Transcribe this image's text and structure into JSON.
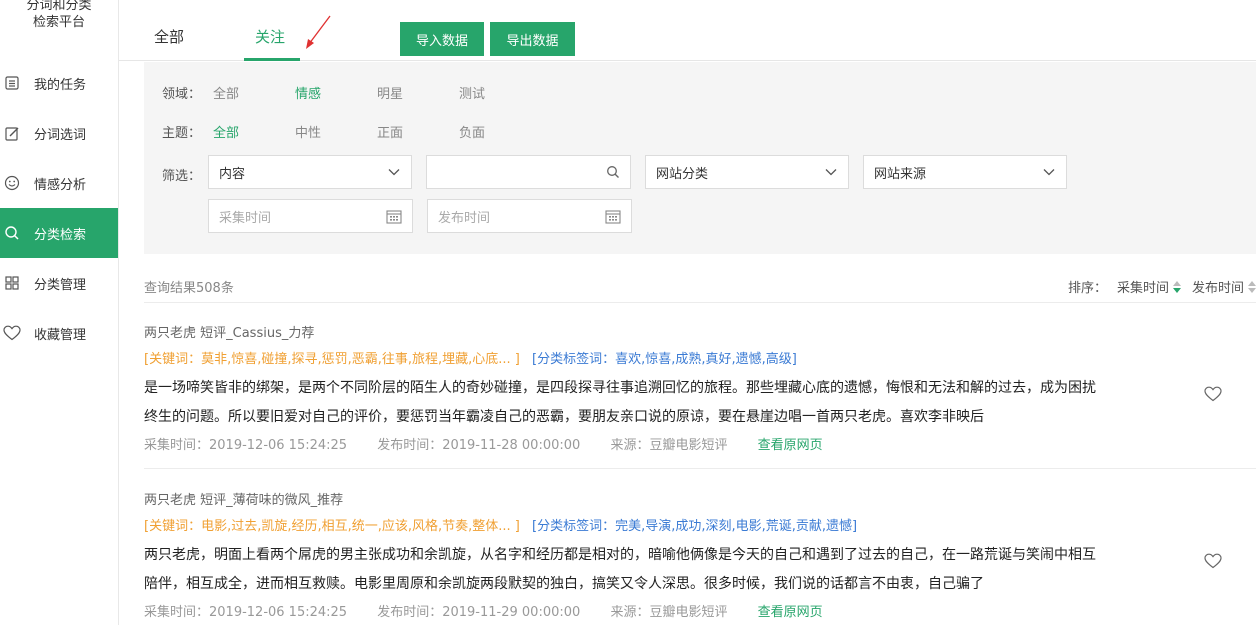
{
  "logo": {
    "line1": "分词和分类",
    "line2": "检索平台"
  },
  "sidebar": {
    "items": [
      {
        "label": "我的任务",
        "icon": "list-icon"
      },
      {
        "label": "分词选词",
        "icon": "edit-icon"
      },
      {
        "label": "情感分析",
        "icon": "smile-icon"
      },
      {
        "label": "分类检索",
        "icon": "search-icon",
        "active": true
      },
      {
        "label": "分类管理",
        "icon": "grid-icon"
      },
      {
        "label": "收藏管理",
        "icon": "heart-icon"
      }
    ]
  },
  "tabs": {
    "all": "全部",
    "follow": "关注"
  },
  "toolbar": {
    "import_label": "导入数据",
    "export_label": "导出数据"
  },
  "filters": {
    "domain_label": "领域：",
    "domain_options": [
      "全部",
      "情感",
      "明星",
      "测试"
    ],
    "domain_selected": "情感",
    "topic_label": "主题：",
    "topic_options": [
      "全部",
      "中性",
      "正面",
      "负面"
    ],
    "topic_selected": "全部",
    "screen_label": "筛选：",
    "content_select": "内容",
    "search_value": "",
    "site_category": "网站分类",
    "site_source": "网站来源",
    "collect_time_placeholder": "采集时间",
    "publish_time_placeholder": "发布时间"
  },
  "results": {
    "count_text": "查询结果508条",
    "sort_label": "排序：",
    "sort_collect": "采集时间",
    "sort_publish": "发布时间"
  },
  "items": [
    {
      "title": "两只老虎 短评_Cassius_力荐",
      "keywords": "[关键词：莫非,惊喜,碰撞,探寻,惩罚,恶霸,往事,旅程,埋藏,心底... ]",
      "class_tags": "[分类标签词：喜欢,惊喜,成熟,真好,遗憾,高级]",
      "body": "是一场啼笑皆非的绑架，是两个不同阶层的陌生人的奇妙碰撞，是四段探寻往事追溯回忆的旅程。那些埋藏心底的遗憾，悔恨和无法和解的过去，成为困扰终生的问题。所以要旧爱对自己的评价，要惩罚当年霸凌自己的恶霸，要朋友亲口说的原谅，要在悬崖边唱一首两只老虎。喜欢李非映后",
      "collect_time": "采集时间：2019-12-06 15:24:25",
      "publish_time": "发布时间：2019-11-28 00:00:00",
      "source": "来源：豆瓣电影短评",
      "link": "查看原网页"
    },
    {
      "title": "两只老虎 短评_薄荷味的微风_推荐",
      "keywords": "[关键词：电影,过去,凯旋,经历,相互,统一,应该,风格,节奏,整体... ]",
      "class_tags": "[分类标签词：完美,导演,成功,深刻,电影,荒诞,贡献,遗憾]",
      "body": "两只老虎，明面上看两个屌虎的男主张成功和余凯旋，从名字和经历都是相对的，暗喻他俩像是今天的自己和遇到了过去的自己，在一路荒诞与笑闹中相互陪伴，相互成全，进而相互救赎。电影里周原和余凯旋两段默契的独白，搞笑又令人深思。很多时候，我们说的话都言不由衷，自己骗了",
      "collect_time": "采集时间：2019-12-06 15:24:25",
      "publish_time": "发布时间：2019-11-29 00:00:00",
      "source": "来源：豆瓣电影短评",
      "link": "查看原网页"
    }
  ],
  "colors": {
    "accent": "#27a56b",
    "keyword": "#f0a033",
    "tag": "#3b7bd4"
  }
}
